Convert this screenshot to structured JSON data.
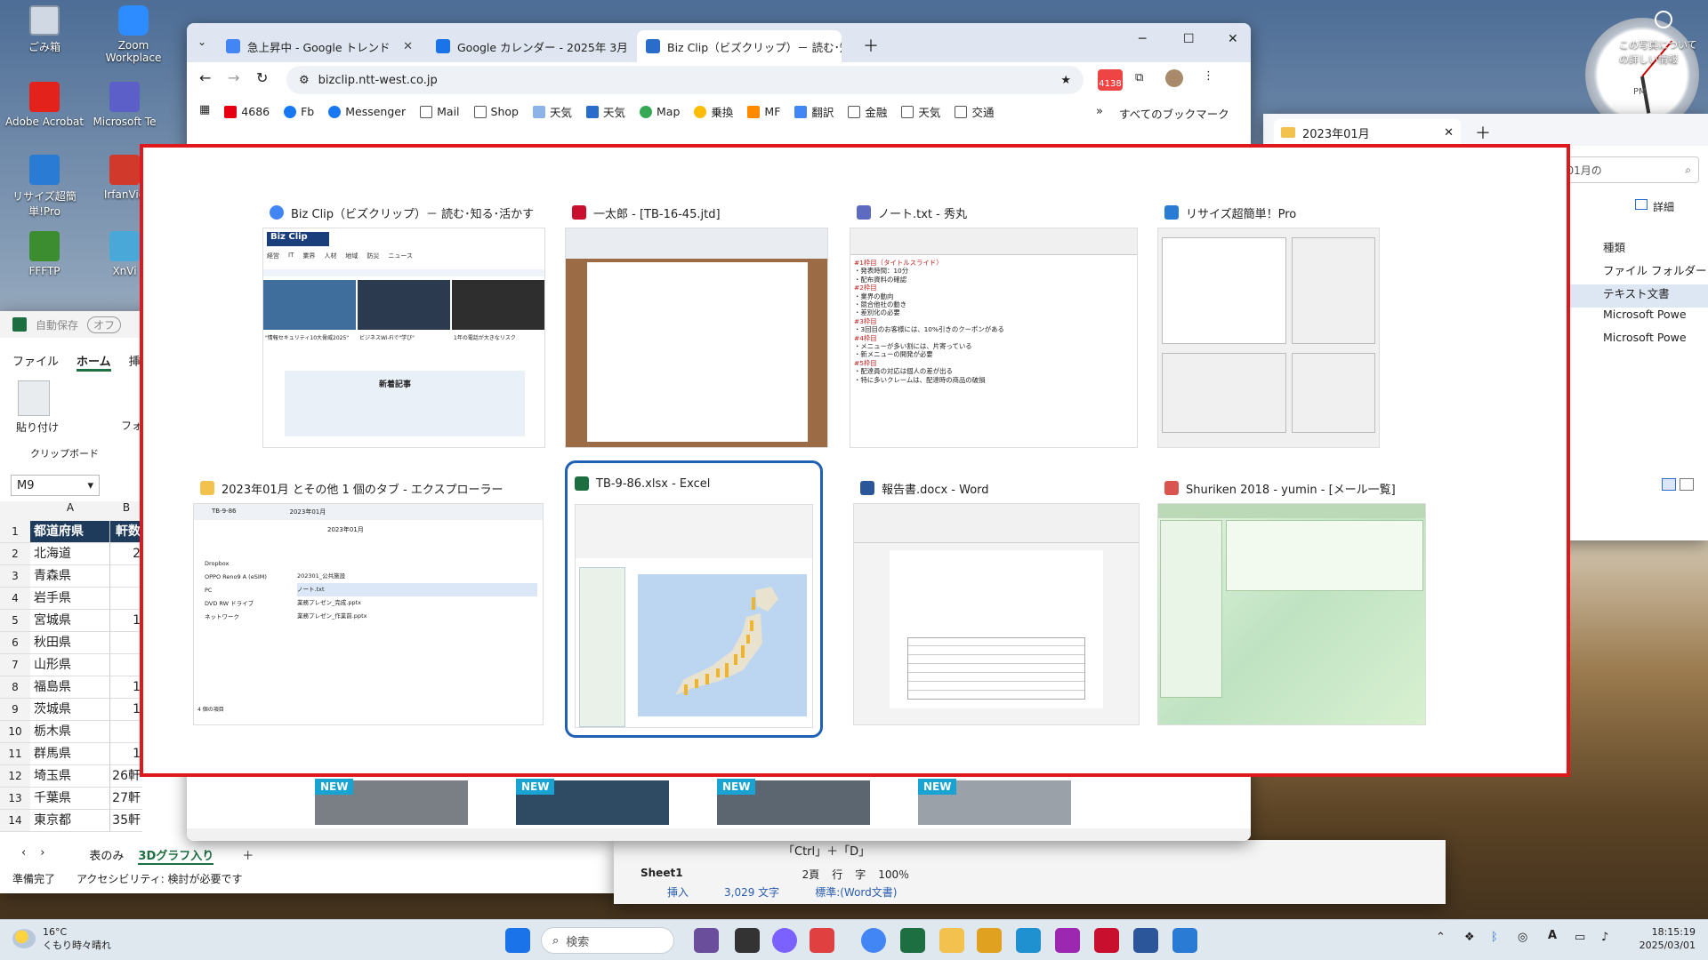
{
  "desktop_icons": [
    {
      "label": "ごみ箱",
      "color": "#cfd8e3"
    },
    {
      "label": "Zoom Workplace",
      "color": "#2d8cff"
    },
    {
      "label": "Adobe Acrobat",
      "color": "#e3231b"
    },
    {
      "label": "Microsoft Te",
      "color": "#5b5fc7"
    },
    {
      "label": "リサイズ超簡単!Pro",
      "color": "#2a7bd4"
    },
    {
      "label": "IrfanVie",
      "color": "#d13a2a"
    },
    {
      "label": "FFFTP",
      "color": "#3c8d2f"
    },
    {
      "label": "XnVi",
      "color": "#4aa8d8"
    }
  ],
  "gadget": {
    "text": "この写真についての詳しい情報",
    "clock_label": "PM"
  },
  "chrome": {
    "tabs": [
      {
        "title": "急上昇中 - Google トレンド"
      },
      {
        "title": "Google カレンダー - 2025年 3月"
      },
      {
        "title": "Biz Clip（ビズクリップ）－ 読む･知る･活かす"
      }
    ],
    "url": "bizclip.ntt-west.co.jp",
    "mail_badge": "4138",
    "bookmarks": [
      "4686",
      "Fb",
      "Messenger",
      "Mail",
      "Shop",
      "天気",
      "天気",
      "Map",
      "乗換",
      "MF",
      "翻訳",
      "金融",
      "天気",
      "交通"
    ],
    "all_bookmarks": "すべてのブックマーク",
    "new_badge": "NEW"
  },
  "explorer_bg": {
    "tab": "2023年01月",
    "search": "2023年01月の",
    "view": "詳細",
    "col_type": "種類",
    "rows": [
      "ファイル フォルダー",
      "テキスト文書",
      "Microsoft Powe",
      "Microsoft Powe"
    ],
    "tick": [
      "1",
      "0",
      "0",
      "0"
    ]
  },
  "excel_bg": {
    "autosave": "自動保存",
    "autosave_state": "オフ",
    "tabs": [
      "ファイル",
      "ホーム",
      "挿入"
    ],
    "paste": "貼り付け",
    "font_group": "フォ",
    "clipboard": "クリップボード",
    "namebox": "M9",
    "col_a": "A",
    "col_b": "B",
    "rows": [
      {
        "n": "1",
        "a": "都道府県",
        "b": "軒数"
      },
      {
        "n": "2",
        "a": "北海道",
        "b": "2"
      },
      {
        "n": "3",
        "a": "青森県",
        "b": ""
      },
      {
        "n": "4",
        "a": "岩手県",
        "b": ""
      },
      {
        "n": "5",
        "a": "宮城県",
        "b": "1"
      },
      {
        "n": "6",
        "a": "秋田県",
        "b": ""
      },
      {
        "n": "7",
        "a": "山形県",
        "b": ""
      },
      {
        "n": "8",
        "a": "福島県",
        "b": "1"
      },
      {
        "n": "9",
        "a": "茨城県",
        "b": "1"
      },
      {
        "n": "10",
        "a": "栃木県",
        "b": ""
      },
      {
        "n": "11",
        "a": "群馬県",
        "b": "1"
      },
      {
        "n": "12",
        "a": "埼玉県",
        "b": "26軒"
      },
      {
        "n": "13",
        "a": "千葉県",
        "b": "27軒"
      },
      {
        "n": "14",
        "a": "東京都",
        "b": "35軒"
      }
    ],
    "sheets": [
      "表のみ",
      "3Dグラフ入り"
    ],
    "status": "準備完了",
    "access": "アクセシビリティ: 検討が必要です"
  },
  "word_bg": {
    "hint": "「Ctrl」＋「D」",
    "pages": "2頁",
    "col1": "行",
    "col2": "字",
    "zoom": "100％",
    "sheet": "Sheet1",
    "mode": "挿入",
    "count": "3,029 文字",
    "style": "標準:(Word文書)"
  },
  "switcher": {
    "cards": [
      {
        "title": "Biz Clip（ビズクリップ）－ 読む･知る･活かす - Googl...",
        "color": "#4285f4"
      },
      {
        "title": "一太郎 - [TB-16-45.jtd]",
        "color": "#c8102e"
      },
      {
        "title": "ノート.txt - 秀丸",
        "color": "#5c6bc0"
      },
      {
        "title": "リサイズ超簡単！Pro",
        "color": "#2a7bd4"
      },
      {
        "title": "2023年01月 とその他 1 個のタブ - エクスプローラー",
        "color": "#f2c14e"
      },
      {
        "title": "TB-9-86.xlsx - Excel",
        "color": "#1d6f42"
      },
      {
        "title": "報告書.docx - Word",
        "color": "#2b579a"
      },
      {
        "title": "Shuriken 2018 - yumin - [メール一覧]",
        "color": "#d9534f"
      }
    ],
    "biz": {
      "logo": "Biz Clip",
      "menu": [
        "経営",
        "IT",
        "業界",
        "人材",
        "地域",
        "防災",
        "ニュース"
      ],
      "new_articles": "新着記事",
      "headline1": "\"情報セキュリティ10大脅威2025\"",
      "headline2": "ビジネスWi-Fiで\"学び\"",
      "headline3": "1年の電話が大きなリスク"
    },
    "memo": [
      "#1枠目（タイトルスライド）",
      "・発表時間：10分",
      "・配布資料の確認",
      "#2枠目",
      "・業界の動向",
      "・競合他社の動き",
      "・差別化の必要",
      "#3枠目",
      "・3回目のお客様には、10%引きのクーポンがある",
      "#4枠目",
      "・メニューが多い割には、片寄っている",
      "・新メニューの開発が必要",
      "#5枠目",
      "・配達員の対応は個人の差が出る",
      "・特に多いクレームは、配達時の商品の破損"
    ],
    "explorer": {
      "tabs": [
        "TB-9-86",
        "2023年01月"
      ],
      "path": "2023年01月",
      "items": [
        "202301_公共施設",
        "ノート.txt",
        "業務プレゼン_完成.pptx",
        "業務プレゼン_作業前.pptx"
      ],
      "side": [
        "Dropbox",
        "OPPO Reno9 A (eSIM)",
        "PC",
        "DVD RW ドライブ",
        "ネットワーク"
      ],
      "status": "4 個の項目"
    }
  },
  "taskbar": {
    "temp": "16°C",
    "weather": "くもり時々晴れ",
    "search": "検索",
    "time": "18:15:19",
    "date": "2025/03/01"
  }
}
